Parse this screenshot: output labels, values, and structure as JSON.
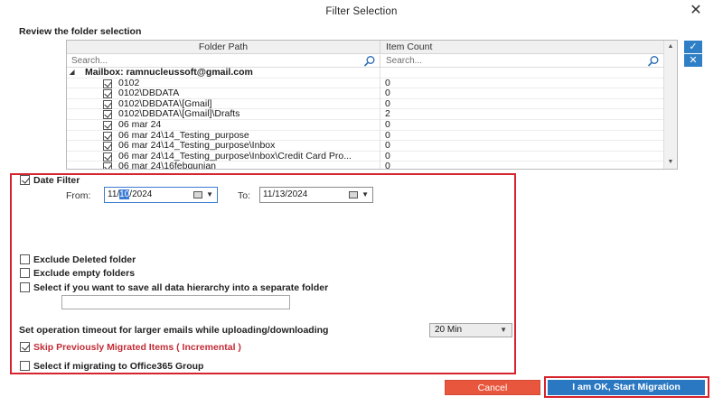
{
  "window": {
    "title": "Filter Selection",
    "close_glyph": "✕"
  },
  "review": {
    "heading": "Review the folder selection"
  },
  "grid": {
    "col_folder": "Folder Path",
    "col_count": "Item Count",
    "search_placeholder_folder": "Search...",
    "search_placeholder_count": "Search...",
    "root_label": "Mailbox: ramnucleussoft@gmail.com",
    "rows": [
      {
        "path": "0102",
        "count": "0"
      },
      {
        "path": "0102\\DBDATA",
        "count": "0"
      },
      {
        "path": "0102\\DBDATA\\[Gmail]",
        "count": "0"
      },
      {
        "path": "0102\\DBDATA\\[Gmail]\\Drafts",
        "count": "2"
      },
      {
        "path": "06 mar 24",
        "count": "0"
      },
      {
        "path": "06 mar 24\\14_Testing_purpose",
        "count": "0"
      },
      {
        "path": "06 mar 24\\14_Testing_purpose\\Inbox",
        "count": "0"
      },
      {
        "path": "06 mar 24\\14_Testing_purpose\\Inbox\\Credit Card Pro...",
        "count": "0"
      },
      {
        "path": "06 mar 24\\16febgunjan",
        "count": "0"
      }
    ]
  },
  "side_buttons": {
    "select_all_glyph": "✓",
    "deselect_all_glyph": "✕"
  },
  "filters": {
    "date_filter_label": "Date Filter",
    "date_filter_checked": true,
    "from_label": "From:",
    "from_value_pre": "11/",
    "from_value_highlight": "10",
    "from_value_post": "/2024",
    "to_label": "To:",
    "to_value": "11/13/2024",
    "exclude_deleted_label": "Exclude Deleted folder",
    "exclude_empty_label": "Exclude empty folders",
    "separate_folder_label": "Select if you want to save all data hierarchy into a separate folder",
    "separate_folder_value": "",
    "timeout_label": "Set operation timeout for larger emails while uploading/downloading",
    "timeout_value": "20 Min",
    "skip_label": "Skip Previously Migrated Items ( Incremental )",
    "skip_checked": true,
    "office365_label": "Select if migrating to Office365 Group"
  },
  "buttons": {
    "cancel": "Cancel",
    "ok": "I am OK, Start Migration"
  },
  "colors": {
    "accent_blue": "#2b78c2",
    "cancel_orange": "#e8573d",
    "highlight_red": "#d7232d",
    "skip_text_red": "#c22b35"
  },
  "icons": {
    "search": "magnifier-icon",
    "calendar": "calendar-icon",
    "dropdown": "chevron-down-icon"
  }
}
